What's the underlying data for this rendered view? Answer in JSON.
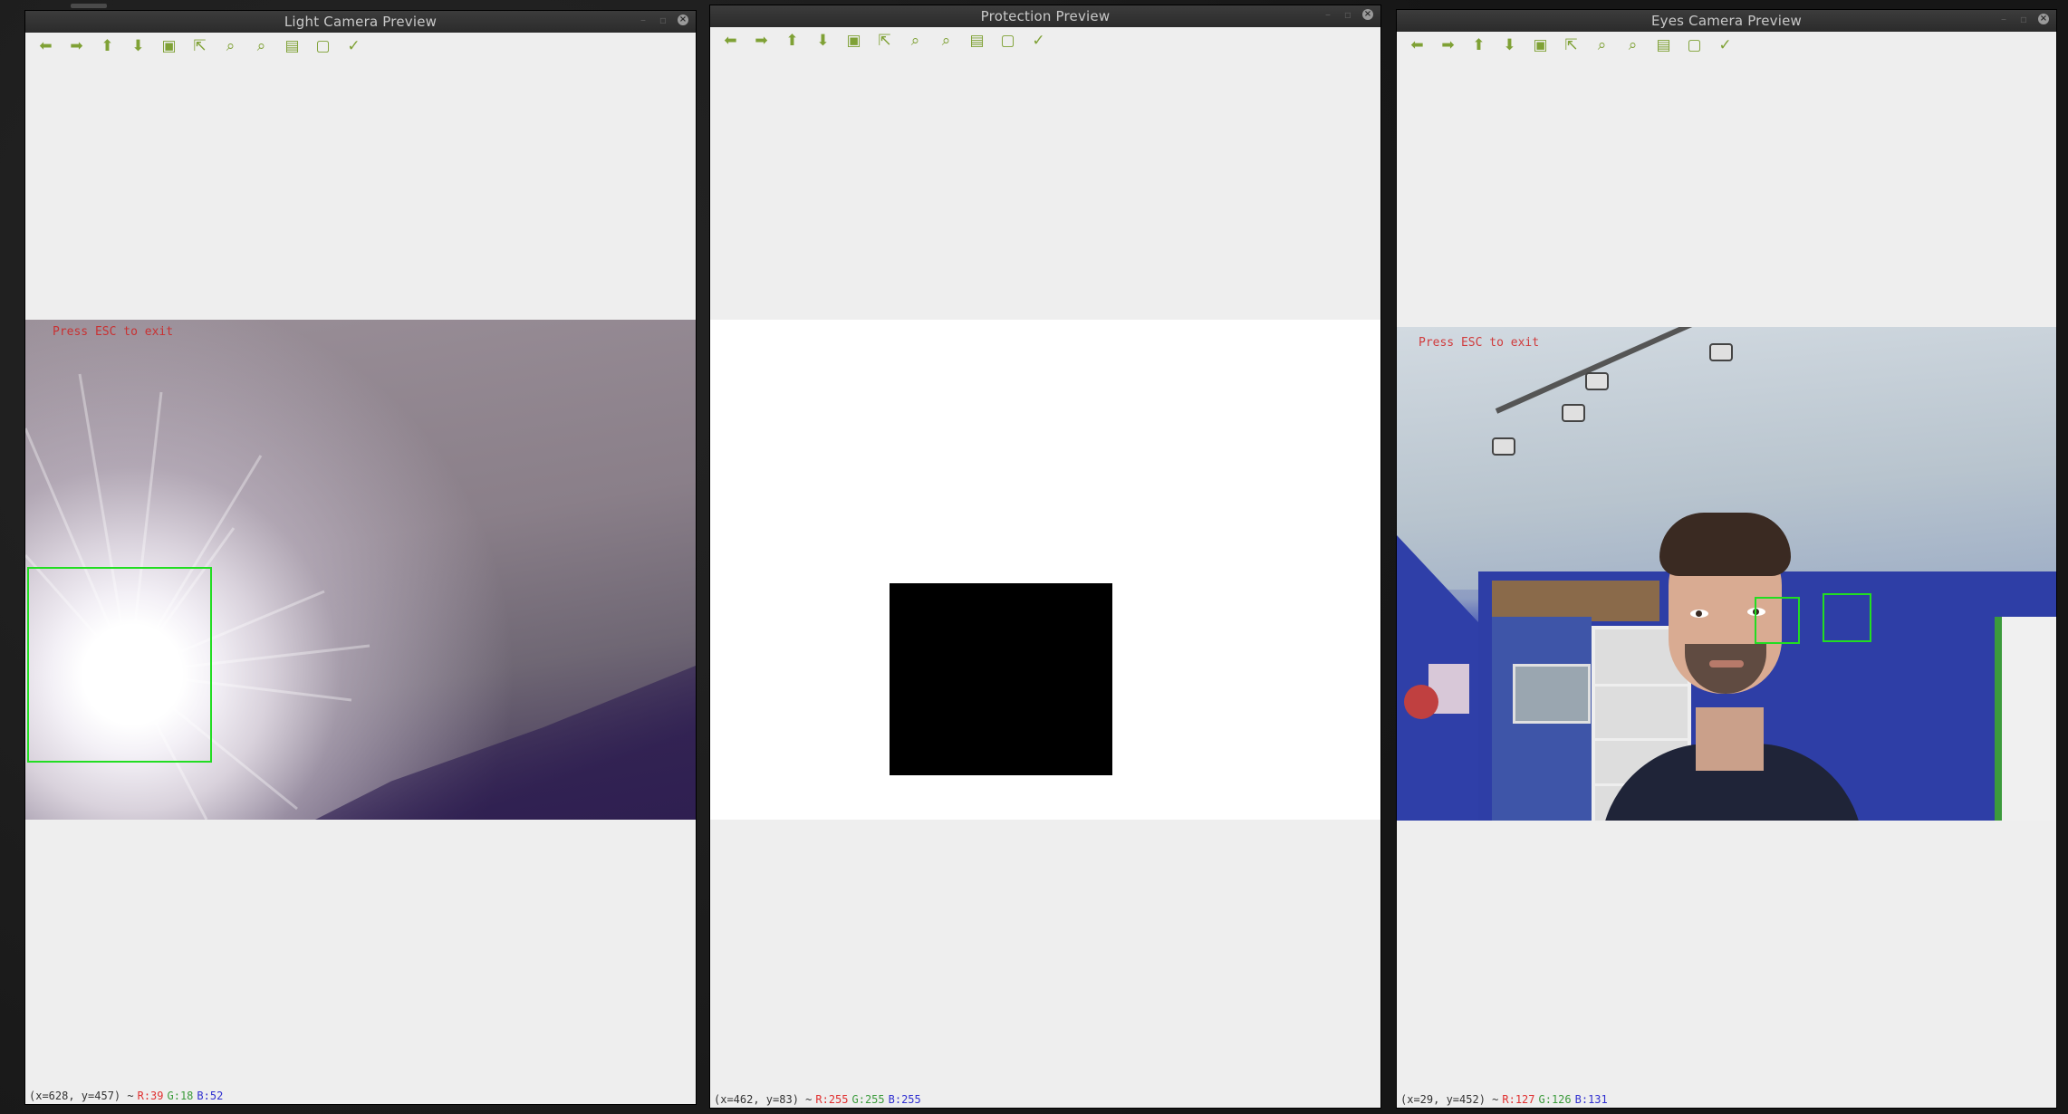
{
  "windows": {
    "light": {
      "title": "Light Camera Preview",
      "overlay_text": "Press ESC to exit",
      "status": {
        "coords": "(x=628, y=457) ~",
        "r": "R:39",
        "g": "G:18",
        "b": "B:52"
      }
    },
    "protection": {
      "title": "Protection Preview",
      "status": {
        "coords": "(x=462, y=83) ~",
        "r": "R:255",
        "g": "G:255",
        "b": "B:255"
      }
    },
    "eyes": {
      "title": "Eyes Camera Preview",
      "overlay_text": "Press ESC to exit",
      "status": {
        "coords": "(x=29, y=452) ~",
        "r": "R:127",
        "g": "G:126",
        "b": "B:131"
      }
    }
  },
  "toolbar_icons": [
    "arrow-left-icon",
    "arrow-right-icon",
    "arrow-up-icon",
    "arrow-down-icon",
    "zoom-fit-icon",
    "zoom-reset-icon",
    "zoom-in-icon",
    "zoom-out-icon",
    "save-icon",
    "properties-icon",
    "settings-icon"
  ],
  "colors": {
    "detection_box": "#22dd22",
    "toolbar_icon": "#7fa135",
    "overlay_text": "#d02020"
  }
}
